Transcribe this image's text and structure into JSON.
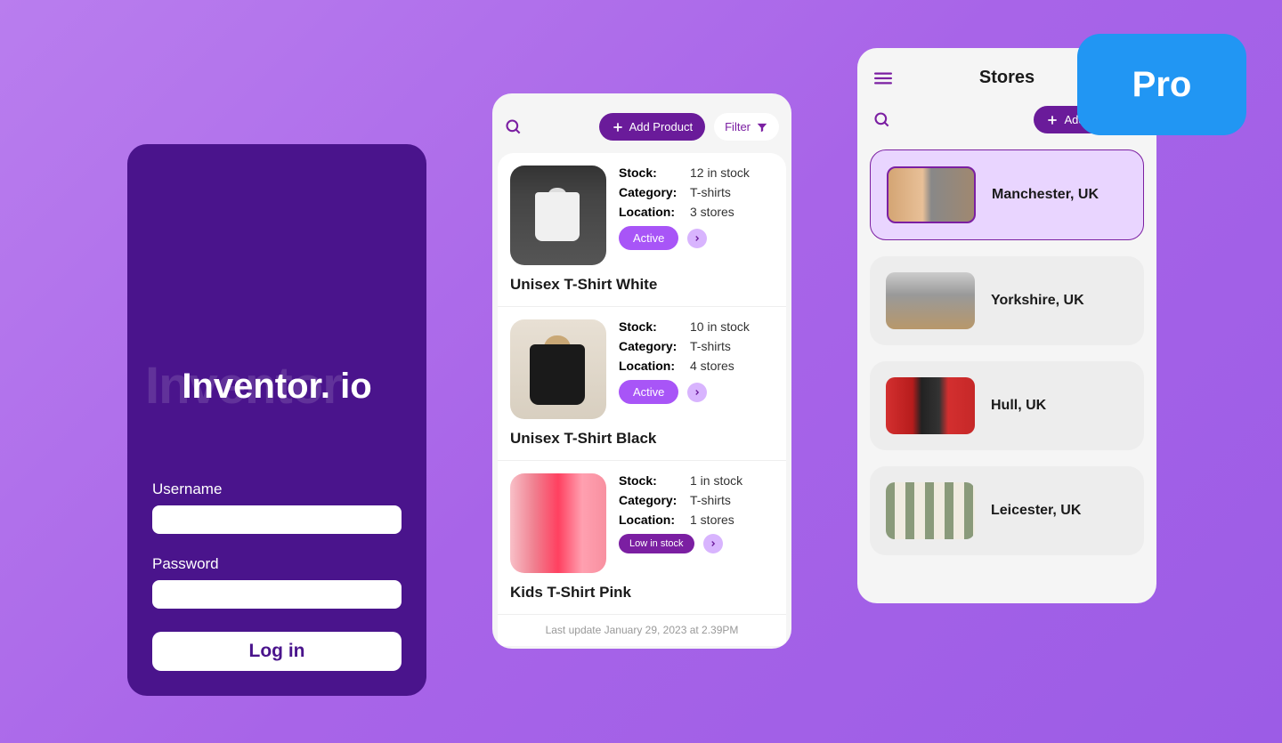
{
  "pro_badge": "Pro",
  "login": {
    "brand_bg": "Inventor",
    "brand": "Inventor. io",
    "username_label": "Username",
    "password_label": "Password",
    "login_button": "Log in"
  },
  "products": {
    "add_label": "Add Product",
    "filter_label": "Filter",
    "items": [
      {
        "stock_label": "Stock:",
        "stock_value": "12 in stock",
        "category_label": "Category:",
        "category_value": "T-shirts",
        "location_label": "Location:",
        "location_value": "3 stores",
        "status": "Active",
        "title": "Unisex T-Shirt White"
      },
      {
        "stock_label": "Stock:",
        "stock_value": "10 in stock",
        "category_label": "Category:",
        "category_value": "T-shirts",
        "location_label": "Location:",
        "location_value": "4 stores",
        "status": "Active",
        "title": "Unisex T-Shirt Black"
      },
      {
        "stock_label": "Stock:",
        "stock_value": "1 in stock",
        "category_label": "Category:",
        "category_value": "T-shirts",
        "location_label": "Location:",
        "location_value": "1 stores",
        "status": "Low in stock",
        "title": "Kids T-Shirt Pink"
      }
    ],
    "last_update": "Last update January 29, 2023 at 2.39PM"
  },
  "stores": {
    "title": "Stores",
    "add_label": "Add Product",
    "items": [
      {
        "name": "Manchester, UK"
      },
      {
        "name": "Yorkshire, UK"
      },
      {
        "name": "Hull, UK"
      },
      {
        "name": "Leicester, UK"
      }
    ]
  }
}
